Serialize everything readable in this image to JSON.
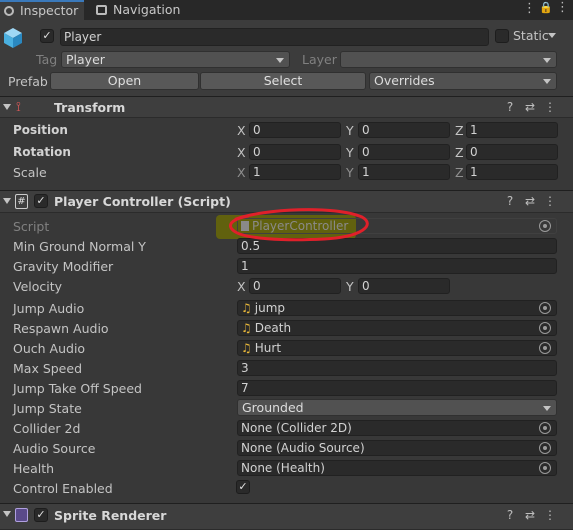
{
  "tabs": [
    {
      "label": "Inspector"
    },
    {
      "label": "Navigation"
    }
  ],
  "object": {
    "name": "Player",
    "static_label": "Static",
    "tag_label": "Tag",
    "tag_value": "Player",
    "layer_label": "Layer",
    "layer_value": "",
    "prefab_label": "Prefab",
    "open_label": "Open",
    "select_label": "Select",
    "overrides_label": "Overrides"
  },
  "transform": {
    "title": "Transform",
    "rows": [
      {
        "label": "Position",
        "x": "0",
        "y": "0",
        "z": "1"
      },
      {
        "label": "Rotation",
        "x": "0",
        "y": "0",
        "z": "0"
      },
      {
        "label": "Scale",
        "x": "1",
        "y": "1",
        "z": "1"
      }
    ],
    "axis": {
      "x": "X",
      "y": "Y",
      "z": "Z"
    }
  },
  "player_controller": {
    "title": "Player Controller (Script)",
    "script_label": "Script",
    "script_value": "PlayerController",
    "min_ground_label": "Min Ground Normal Y",
    "min_ground_value": "0.5",
    "gravity_label": "Gravity Modifier",
    "gravity_value": "1",
    "velocity_label": "Velocity",
    "velocity_x": "0",
    "velocity_y": "0",
    "jump_audio_label": "Jump Audio",
    "jump_audio_value": "jump",
    "respawn_audio_label": "Respawn Audio",
    "respawn_audio_value": "Death",
    "ouch_audio_label": "Ouch Audio",
    "ouch_audio_value": "Hurt",
    "max_speed_label": "Max Speed",
    "max_speed_value": "3",
    "jump_takeoff_label": "Jump Take Off Speed",
    "jump_takeoff_value": "7",
    "jump_state_label": "Jump State",
    "jump_state_value": "Grounded",
    "collider_label": "Collider 2d",
    "collider_value": "None (Collider 2D)",
    "audio_source_label": "Audio Source",
    "audio_source_value": "None (Audio Source)",
    "health_label": "Health",
    "health_value": "None (Health)",
    "control_enabled_label": "Control Enabled",
    "control_enabled": true
  },
  "sprite_renderer": {
    "title": "Sprite Renderer"
  },
  "colors": {
    "accent": "#3a79bb",
    "annotation": "#e0202a",
    "highlight": "#8c8c00"
  }
}
